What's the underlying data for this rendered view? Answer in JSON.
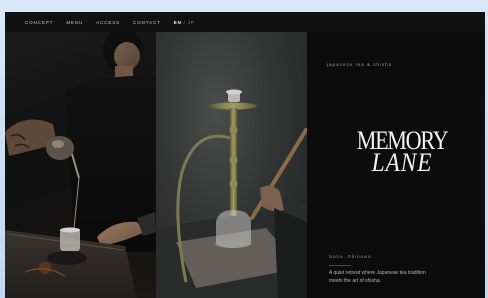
{
  "nav": {
    "items": [
      {
        "label": "CONCEPT"
      },
      {
        "label": "MENU"
      },
      {
        "label": "ACCESS"
      },
      {
        "label": "CONTACT"
      }
    ],
    "lang": {
      "active": "EN",
      "separator": "/",
      "inactive": "JP"
    }
  },
  "hero": {
    "tagline": "japanese tea & shisha",
    "logo_line1": "MEMORY",
    "logo_line2": "LANE",
    "location": "Naha, Okinawa",
    "description": "A quiet retreat where Japanese tea tradition meets the art of shisha."
  },
  "colors": {
    "background": "#0b0b0c",
    "text_primary": "#f3f3f3",
    "text_muted": "#9a9a9a",
    "hookah_brass": "#8f8a5a"
  }
}
